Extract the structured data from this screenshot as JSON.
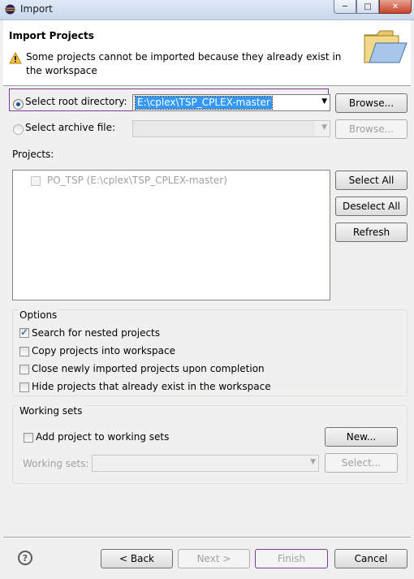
{
  "window": {
    "title": "Import"
  },
  "header": {
    "title": "Import Projects",
    "message": "Some projects cannot be imported because they already exist in the workspace"
  },
  "source": {
    "root_label": "Select root directory:",
    "root_value": "E:\\cplex\\TSP_CPLEX-master",
    "archive_label": "Select archive file:",
    "archive_value": "",
    "browse_label": "Browse...",
    "selected": "root"
  },
  "projects": {
    "label": "Projects:",
    "items": [
      {
        "label": "PO_TSP (E:\\cplex\\TSP_CPLEX-master)",
        "checked": false,
        "enabled": false
      }
    ],
    "select_all": "Select All",
    "deselect_all": "Deselect All",
    "refresh": "Refresh"
  },
  "options": {
    "title": "Options",
    "items": [
      {
        "label": "Search for nested projects",
        "checked": true
      },
      {
        "label": "Copy projects into workspace",
        "checked": false
      },
      {
        "label": "Close newly imported projects upon completion",
        "checked": false
      },
      {
        "label": "Hide projects that already exist in the workspace",
        "checked": false
      }
    ]
  },
  "working_sets": {
    "title": "Working sets",
    "add_label": "Add project to working sets",
    "add_checked": false,
    "new_label": "New...",
    "sets_label": "Working sets:",
    "sets_value": "",
    "select_label": "Select..."
  },
  "footer": {
    "back": "< Back",
    "next": "Next >",
    "finish": "Finish",
    "cancel": "Cancel"
  },
  "colors": {
    "focus": "#7d3c8f",
    "selection": "#3399ff"
  }
}
